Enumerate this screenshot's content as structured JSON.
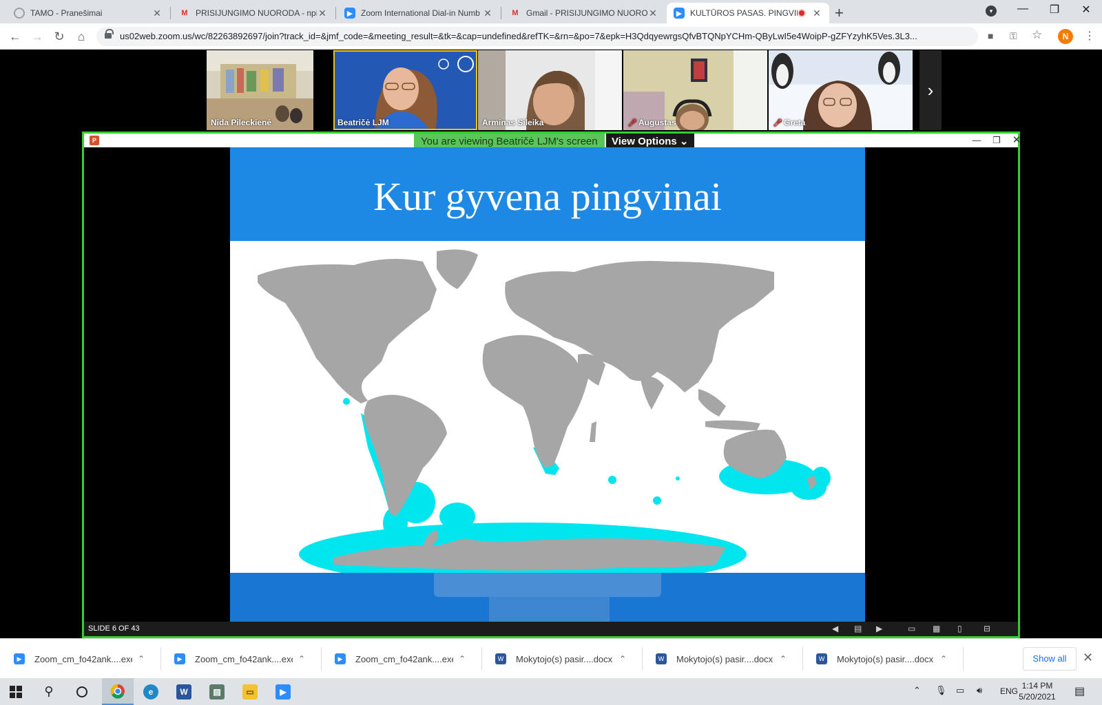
{
  "browser": {
    "tabs": [
      {
        "title": "TAMO - Pranešimai",
        "icon": "tamo-icon"
      },
      {
        "title": "PRISIJUNGIMO NUORODA - npile",
        "icon": "gmail-icon"
      },
      {
        "title": "Zoom International Dial-in Numb",
        "icon": "zoom-icon"
      },
      {
        "title": "Gmail - PRISIJUNGIMO NUORODA",
        "icon": "gmail-icon"
      },
      {
        "title": "KULTŪROS PASAS. PINGVINAI",
        "icon": "zoom-icon",
        "active": true,
        "recording": true
      }
    ],
    "url": "us02web.zoom.us/wc/82263892697/join?track_id=&jmf_code=&meeting_result=&tk=&cap=undefined&refTK=&rn=&po=7&epk=H3QdqyewrgsQfvBTQNpYCHm-QByLwI5e4WoipP-gZFYzyhK5Ves.3L3...",
    "profile_initial": "N"
  },
  "zoom": {
    "participants": [
      {
        "name": "Nida Pileckienė",
        "muted": false
      },
      {
        "name": "Beatričė LJM",
        "muted": false,
        "selected": true
      },
      {
        "name": "Arminas Sileika",
        "muted": false
      },
      {
        "name": "Augustas",
        "muted": true
      },
      {
        "name": "Greta",
        "muted": true
      }
    ],
    "viewing_banner": "You are viewing Beatričė LJM's screen",
    "view_options_label": "View Options",
    "slide_title": "Kur gyvena pingvinai",
    "slide_counter": "SLIDE 6 OF 43",
    "colors": {
      "share_border": "#2fd02f",
      "slide_blue": "#1e88e5",
      "land": "#a6a6a6",
      "habitat": "#00e5ee"
    }
  },
  "downloads": {
    "items": [
      {
        "name": "Zoom_cm_fo42ank....exe",
        "icon": "zoom-icon"
      },
      {
        "name": "Zoom_cm_fo42ank....exe",
        "icon": "zoom-icon"
      },
      {
        "name": "Zoom_cm_fo42ank....exe",
        "icon": "zoom-icon"
      },
      {
        "name": "Mokytojo(s) pasir....docx",
        "icon": "word-icon"
      },
      {
        "name": "Mokytojo(s) pasir....docx",
        "icon": "word-icon"
      },
      {
        "name": "Mokytojo(s) pasir....docx",
        "icon": "word-icon"
      }
    ],
    "show_all_label": "Show all"
  },
  "taskbar": {
    "language": "ENG",
    "time": "1:14 PM",
    "date": "5/20/2021"
  }
}
